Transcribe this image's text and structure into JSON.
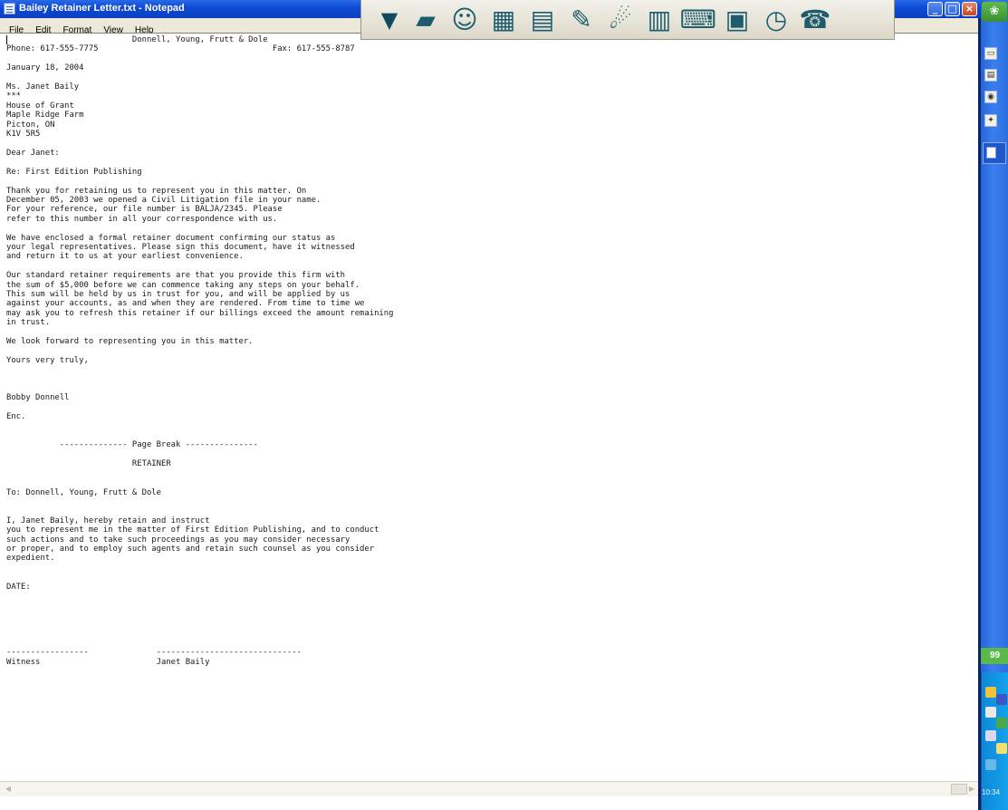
{
  "window": {
    "title": "Bailey Retainer Letter.txt - Notepad",
    "controls": {
      "minimize": "_",
      "maximize": "□",
      "close": "×"
    }
  },
  "menu": [
    "File",
    "Edit",
    "Format",
    "View",
    "Help"
  ],
  "toolbar": {
    "buttons": [
      {
        "name": "dropdown-arrow-icon",
        "glyph": "▼"
      },
      {
        "name": "folder-icon",
        "glyph": "▰"
      },
      {
        "name": "people-icon",
        "glyph": "☺"
      },
      {
        "name": "ledger-icon",
        "glyph": "▦"
      },
      {
        "name": "document-icon",
        "glyph": "▤"
      },
      {
        "name": "notepad-pen-icon",
        "glyph": "✎"
      },
      {
        "name": "satellite-dish-icon",
        "glyph": "☄"
      },
      {
        "name": "books-icon",
        "glyph": "▥"
      },
      {
        "name": "calculator-icon",
        "glyph": "⌨"
      },
      {
        "name": "cash-register-icon",
        "glyph": "▣"
      },
      {
        "name": "stopwatch-icon",
        "glyph": "◷"
      },
      {
        "name": "telephone-icon",
        "glyph": "☎"
      }
    ]
  },
  "document": {
    "lines": [
      "                          Donnell, Young, Frutt & Dole",
      "Phone: 617-555-7775                                    Fax: 617-555-8787",
      "",
      "January 18, 2004",
      "",
      "Ms. Janet Baily",
      "***",
      "House of Grant",
      "Maple Ridge Farm",
      "Picton, ON",
      "K1V 5R5",
      "",
      "Dear Janet:",
      "",
      "Re: First Edition Publishing",
      "",
      "Thank you for retaining us to represent you in this matter. On",
      "December 05, 2003 we opened a Civil Litigation file in your name.",
      "For your reference, our file number is BALJA/2345. Please",
      "refer to this number in all your correspondence with us.",
      "",
      "We have enclosed a formal retainer document confirming our status as",
      "your legal representatives. Please sign this document, have it witnessed",
      "and return it to us at your earliest convenience.",
      "",
      "Our standard retainer requirements are that you provide this firm with",
      "the sum of $5,000 before we can commence taking any steps on your behalf.",
      "This sum will be held by us in trust for you, and will be applied by us",
      "against your accounts, as and when they are rendered. From time to time we",
      "may ask you to refresh this retainer if our billings exceed the amount remaining",
      "in trust.",
      "",
      "We look forward to representing you in this matter.",
      "",
      "Yours very truly,",
      "",
      "",
      "",
      "Bobby Donnell",
      "",
      "Enc.",
      "",
      "",
      "           -------------- Page Break ---------------",
      "",
      "                          RETAINER",
      "",
      "",
      "To: Donnell, Young, Frutt & Dole",
      "",
      "",
      "I, Janet Baily, hereby retain and instruct",
      "you to represent me in the matter of First Edition Publishing, and to conduct",
      "such actions and to take such proceedings as you may consider necessary",
      "or proper, and to employ such agents and retain such counsel as you consider",
      "expedient.",
      "",
      "",
      "DATE:",
      "",
      "",
      "",
      "",
      "",
      "",
      "-----------------              ------------------------------",
      "Witness                        Janet Baily"
    ]
  },
  "tray": {
    "badge": "99",
    "clock": "10:34"
  },
  "colors": {
    "title_bar": "#0f4bd6",
    "menu_bar": "#ece9d8",
    "toolbar_icons": "#1c5c6e",
    "taskbar": "#2c6fe0",
    "tray": "#16a0ea",
    "badge": "#5cb84a"
  }
}
